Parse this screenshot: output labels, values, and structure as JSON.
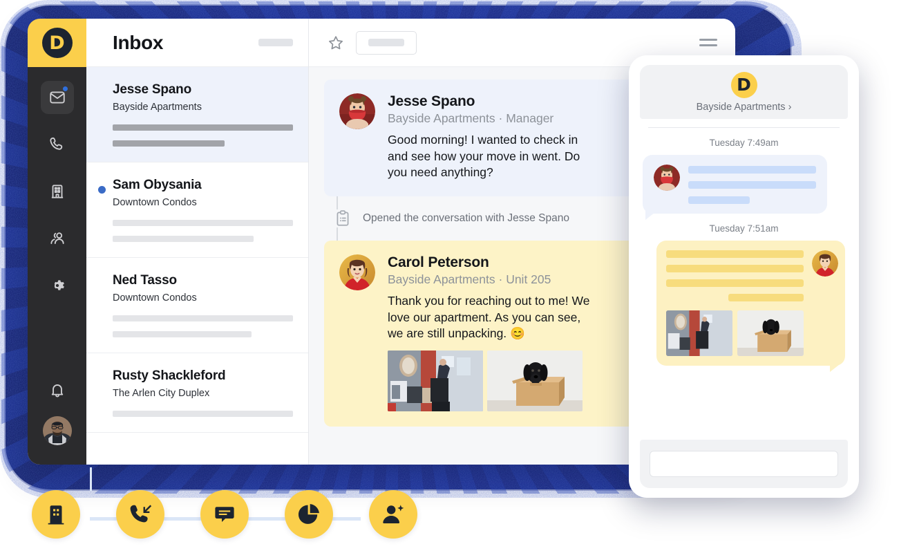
{
  "brand": {
    "logo_letter": "D",
    "yellow": "#FBCF4B",
    "navy": "#15237f",
    "dark": "#2b2b2d"
  },
  "rail": {
    "items": [
      {
        "name": "inbox",
        "icon": "inbox-icon",
        "active": true,
        "badge": true
      },
      {
        "name": "calls",
        "icon": "phone-icon",
        "active": false,
        "badge": false
      },
      {
        "name": "properties",
        "icon": "building-icon",
        "active": false,
        "badge": false
      },
      {
        "name": "residents",
        "icon": "people-icon",
        "active": false,
        "badge": false
      },
      {
        "name": "settings",
        "icon": "gear-icon",
        "active": false,
        "badge": false
      },
      {
        "name": "notifications",
        "icon": "bell-icon",
        "active": false,
        "badge": false
      }
    ],
    "avatar": "user-avatar"
  },
  "list": {
    "title": "Inbox",
    "conversations": [
      {
        "name": "Jesse Spano",
        "property": "Bayside Apartments",
        "selected": true,
        "unread": false
      },
      {
        "name": "Sam Obysania",
        "property": "Downtown Condos",
        "selected": false,
        "unread": true
      },
      {
        "name": "Ned Tasso",
        "property": "Downtown Condos",
        "selected": false,
        "unread": false
      },
      {
        "name": "Rusty Shackleford",
        "property": "The Arlen City Duplex",
        "selected": false,
        "unread": false
      }
    ]
  },
  "thread": {
    "toolbar": {
      "star": "star-icon",
      "menu": "hamburger-menu-icon"
    },
    "messages": [
      {
        "kind": "incoming",
        "sender": "Jesse Spano",
        "meta": "Bayside Apartments · Manager",
        "text": "Good morning! I wanted to check in and see how your move in went. Do you need anything?",
        "attachments": []
      },
      {
        "kind": "outgoing",
        "sender": "Carol Peterson",
        "meta": "Bayside Apartments · Unit 205",
        "text": "Thank you for reaching out to me! We love our apartment. As you can see, we are still unpacking. 😊",
        "attachments": [
          "moving-boxes-photo",
          "dog-in-box-photo"
        ]
      }
    ],
    "event": {
      "icon": "clipboard-icon",
      "text": "Opened the conversation with Jesse Spano"
    }
  },
  "phone": {
    "logo_letter": "D",
    "org": "Bayside Apartments ›",
    "stamps": [
      "Tuesday 7:49am",
      "Tuesday 7:51am"
    ],
    "composer_placeholder": ""
  },
  "pills": [
    {
      "name": "building",
      "icon": "building-icon"
    },
    {
      "name": "incoming-call",
      "icon": "incoming-call-icon"
    },
    {
      "name": "messages",
      "icon": "chat-bubble-icon"
    },
    {
      "name": "analytics",
      "icon": "pie-chart-icon"
    },
    {
      "name": "add-contact",
      "icon": "add-person-icon"
    }
  ]
}
